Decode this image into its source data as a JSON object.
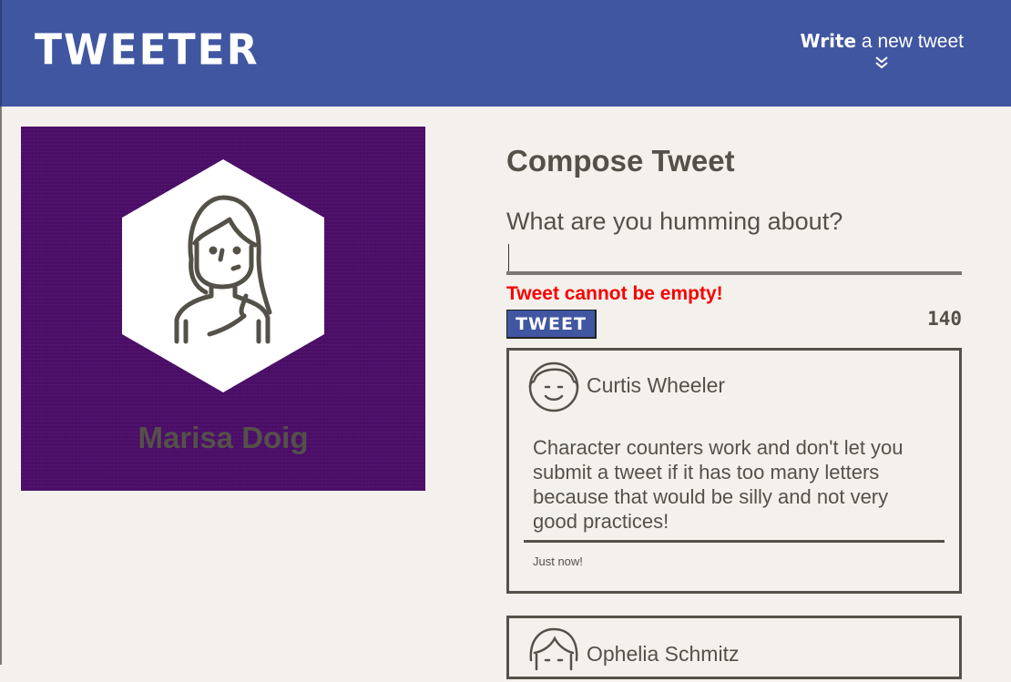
{
  "nav": {
    "brand": "TWEETER",
    "compose_bold": "Write",
    "compose_rest": " a new tweet"
  },
  "profile": {
    "name": "Marisa Doig",
    "background_color": "#4c0e69"
  },
  "compose": {
    "title": "Compose Tweet",
    "placeholder": "What are you humming about?",
    "error": "Tweet cannot be empty!",
    "submit_label": "TWEET",
    "counter": "140"
  },
  "tweets": [
    {
      "user": "Curtis Wheeler",
      "body": "Character counters work and don't let you submit a tweet if it has too many letters because that would be silly and not very good practices!",
      "time": "Just now!"
    },
    {
      "user": "Ophelia Schmitz"
    }
  ],
  "colors": {
    "nav": "#4056a1",
    "background": "#f4f1ec",
    "text": "#545149",
    "error": "#f70000"
  }
}
